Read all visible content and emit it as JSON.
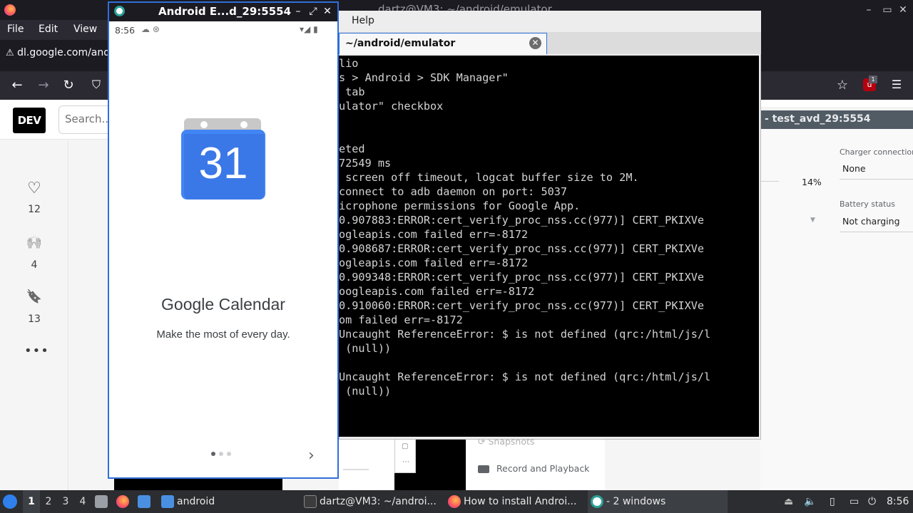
{
  "firefox": {
    "window_title": "dartz@VM3: ~/android/emulator",
    "menu": {
      "file": "File",
      "edit": "Edit",
      "view": "View"
    },
    "tab_title": "dl.google.com/andr",
    "nav": {
      "back": "←",
      "forward": "→",
      "reload": "↻",
      "shield": "⛉"
    },
    "ext_badge": "1"
  },
  "dev": {
    "logo": "DEV",
    "search_placeholder": "Search...",
    "reactions": [
      {
        "icon": "♡",
        "count": "12"
      },
      {
        "icon": "🙌",
        "count": "4"
      },
      {
        "icon": "🔖",
        "count": "13"
      }
    ],
    "more": "•••"
  },
  "extended_controls": {
    "title": "- test_avd_29:5554",
    "charger_label": "Charger connection",
    "charger_value": "None",
    "charge_level": "14%",
    "battery_label": "Battery status",
    "battery_value": "Not charging",
    "snapshots": "Snapshots",
    "record": "Record and Playback"
  },
  "terminal": {
    "menu_help": "Help",
    "tab_title": "~/android/emulator",
    "close": "✕",
    "lines": [
      "lio",
      "s > Android > SDK Manager\"",
      " tab",
      "ulator\" checkbox",
      "",
      "",
      "eted",
      "72549 ms",
      " screen off timeout, logcat buffer size to 2M.",
      "connect to adb daemon on port: 5037",
      "icrophone permissions for Google App.",
      "0.907883:ERROR:cert_verify_proc_nss.cc(977)] CERT_PKIXVe",
      "ogleapis.com failed err=-8172",
      "0.908687:ERROR:cert_verify_proc_nss.cc(977)] CERT_PKIXVe",
      "ogleapis.com failed err=-8172",
      "0.909348:ERROR:cert_verify_proc_nss.cc(977)] CERT_PKIXVe",
      "oogleapis.com failed err=-8172",
      "0.910060:ERROR:cert_verify_proc_nss.cc(977)] CERT_PKIXVe",
      "om failed err=-8172",
      "Uncaught ReferenceError: $ is not defined (qrc:/html/js/l",
      " (null))",
      "",
      "Uncaught ReferenceError: $ is not defined (qrc:/html/js/l",
      " (null))"
    ]
  },
  "emulator": {
    "window_title": "Android E...d_29:5554",
    "buttons": {
      "minimize": "–",
      "maximize": "⤢",
      "close": "✕"
    },
    "status_time": "8:56",
    "status_icons": "☁ ⊛",
    "status_right": "▾◢ ▮",
    "calendar_day": "31",
    "app_title": "Google Calendar",
    "app_subtitle": "Make the most of every day.",
    "page_dots": 3,
    "active_dot": 0,
    "next": "›"
  },
  "taskbar": {
    "workspaces": [
      "1",
      "2",
      "3",
      "4"
    ],
    "active_workspace": "1",
    "tasks": [
      {
        "label": "android"
      },
      {
        "label": "dartz@VM3: ~/androi..."
      },
      {
        "label": "How to install Androi..."
      },
      {
        "label": "- 2 windows"
      }
    ],
    "clock": "8:56"
  },
  "colors": {
    "calendar_blue": "#4285f4",
    "focus_border": "#2f6fdb",
    "terminal_bg": "#000000",
    "terminal_fg": "#d3d3d3",
    "taskbar_bg": "#2b2d30"
  }
}
